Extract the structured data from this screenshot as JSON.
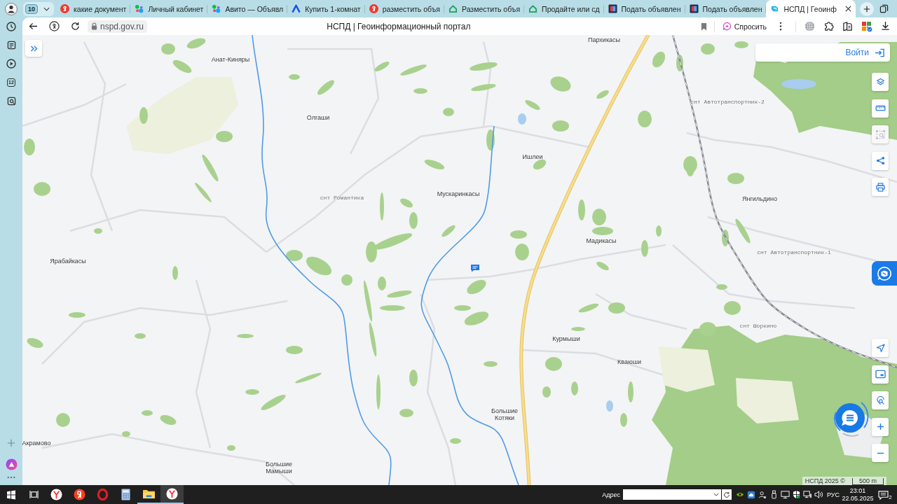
{
  "browser": {
    "tab_group": {
      "count": "10"
    },
    "tabs": [
      {
        "title": "какие документ",
        "kind": "ya",
        "selected": false
      },
      {
        "title": "Личный кабинет",
        "kind": "dots",
        "selected": false
      },
      {
        "title": "Авито — Объявл",
        "kind": "dots",
        "selected": false
      },
      {
        "title": "Купить 1-комнат",
        "kind": "arrow",
        "selected": false
      },
      {
        "title": "разместить объя",
        "kind": "ya",
        "selected": false
      },
      {
        "title": "Разместить объя",
        "kind": "house",
        "selected": false
      },
      {
        "title": "Продайте или сд",
        "kind": "house",
        "selected": false
      },
      {
        "title": "Подать объявлен",
        "kind": "square",
        "selected": false
      },
      {
        "title": "Подать объявлен",
        "kind": "square",
        "selected": false
      },
      {
        "title": "НСПД | Геоинф",
        "kind": "nspd",
        "selected": true
      }
    ]
  },
  "sidebar": {
    "calendar_day": "12"
  },
  "toolbar": {
    "url": "nspd.gov.ru",
    "page_title": "НСПД | Геоинформационный портал",
    "ask_button": "Спросить"
  },
  "map": {
    "labels": [
      {
        "text": "Пархикасы",
        "kind": "settlement"
      },
      {
        "text": "Анат-Киняры",
        "kind": "settlement"
      },
      {
        "text": "снт Автотранспортник-2",
        "kind": "snt"
      },
      {
        "text": "Олгаши",
        "kind": "settlement"
      },
      {
        "text": "Ишлеи",
        "kind": "settlement"
      },
      {
        "text": "Мускаринкасы",
        "kind": "settlement"
      },
      {
        "text": "снт Романтика",
        "kind": "snt"
      },
      {
        "text": "Янгильдино",
        "kind": "settlement"
      },
      {
        "text": "Мадикасы",
        "kind": "settlement"
      },
      {
        "text": "снт Автотранспортник-1",
        "kind": "snt"
      },
      {
        "text": "Ярабайкасы",
        "kind": "settlement"
      },
      {
        "text": "снт Шоркино",
        "kind": "snt"
      },
      {
        "text": "Курмыши",
        "kind": "settlement"
      },
      {
        "text": "Кваюши",
        "kind": "settlement"
      },
      {
        "text": "Большие Котяки",
        "kind": "settlement"
      },
      {
        "text": "Акрамово",
        "kind": "settlement"
      },
      {
        "text": "Большие Мамыши",
        "kind": "settlement"
      }
    ],
    "login_button": "Войти",
    "tools": [
      {
        "kind": "layers",
        "disabled": false
      },
      {
        "kind": "ruler",
        "disabled": false
      },
      {
        "kind": "select",
        "disabled": true
      },
      {
        "kind": "share",
        "disabled": false
      },
      {
        "kind": "print",
        "disabled": false
      }
    ],
    "nav_tools": [
      {
        "kind": "locate"
      },
      {
        "kind": "minimap"
      },
      {
        "kind": "find-place"
      },
      {
        "kind": "zoom-in"
      },
      {
        "kind": "zoom-out"
      }
    ],
    "attribution": "НСПД 2025 ©",
    "scale": "500 m"
  },
  "taskbar": {
    "apps": [
      {
        "kind": "browser",
        "running": false,
        "selected": false
      },
      {
        "kind": "search",
        "running": false,
        "selected": false
      },
      {
        "kind": "ring",
        "running": false,
        "selected": false
      },
      {
        "kind": "calculator",
        "running": false,
        "selected": false
      },
      {
        "kind": "folder",
        "running": true,
        "selected": false
      },
      {
        "kind": "browser",
        "running": true,
        "selected": true
      }
    ],
    "address_label": "Адрес",
    "language": "РУС",
    "time": "23:01",
    "date": "22.05.2025",
    "notification_count": "2"
  }
}
